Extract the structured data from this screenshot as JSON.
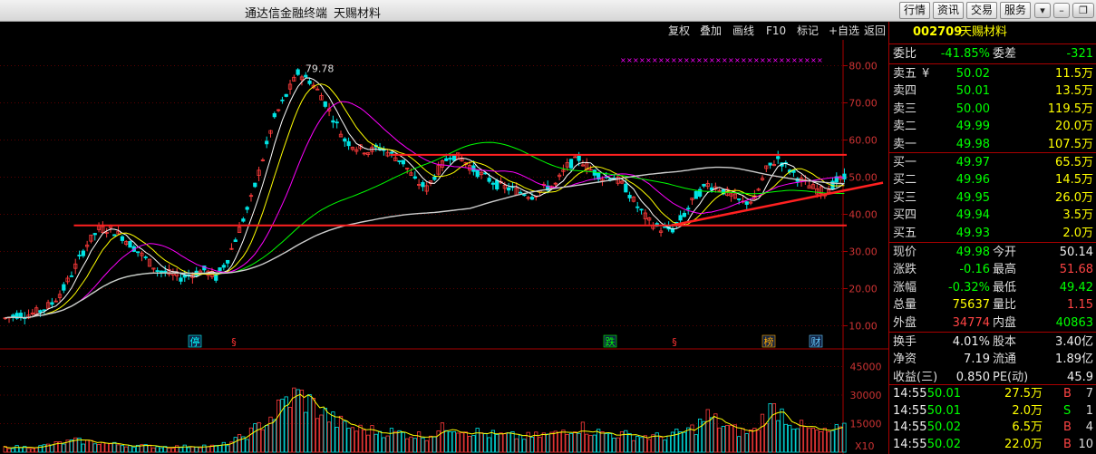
{
  "app": {
    "title": "通达信金融终端",
    "stock": "天赐材料"
  },
  "top_buttons": [
    "行情",
    "资讯",
    "交易",
    "服务"
  ],
  "window_icons": [
    "down-arrow-icon",
    "minimize-icon",
    "restore-icon",
    "close-icon"
  ],
  "chart_toolbar": [
    "复权",
    "叠加",
    "画线",
    "F10",
    "标记",
    "+自选",
    "返回"
  ],
  "panel": {
    "code": "002709",
    "name": "天赐材料",
    "weibi_label": "委比",
    "weibi": "-41.85%",
    "weicha_label": "委差",
    "weicha": "-321",
    "asks": [
      {
        "label": "卖五",
        "mark": "¥",
        "price": "50.02",
        "vol": "11.5万"
      },
      {
        "label": "卖四",
        "price": "50.01",
        "vol": "13.5万"
      },
      {
        "label": "卖三",
        "price": "50.00",
        "vol": "119.5万"
      },
      {
        "label": "卖二",
        "price": "49.99",
        "vol": "20.0万"
      },
      {
        "label": "卖一",
        "price": "49.98",
        "vol": "107.5万"
      }
    ],
    "bids": [
      {
        "label": "买一",
        "price": "49.97",
        "vol": "65.5万"
      },
      {
        "label": "买二",
        "price": "49.96",
        "vol": "14.5万"
      },
      {
        "label": "买三",
        "price": "49.95",
        "vol": "26.0万"
      },
      {
        "label": "买四",
        "price": "49.94",
        "vol": "3.5万"
      },
      {
        "label": "买五",
        "price": "49.93",
        "vol": "2.0万"
      }
    ],
    "quote": [
      {
        "l1": "现价",
        "v1": "49.98",
        "c1": "g",
        "l2": "今开",
        "v2": "50.14",
        "c2": "w"
      },
      {
        "l1": "涨跌",
        "v1": "-0.16",
        "c1": "g",
        "l2": "最高",
        "v2": "51.68",
        "c2": "r"
      },
      {
        "l1": "涨幅",
        "v1": "-0.32%",
        "c1": "g",
        "l2": "最低",
        "v2": "49.42",
        "c2": "g"
      },
      {
        "l1": "总量",
        "v1": "75637",
        "c1": "y",
        "l2": "量比",
        "v2": "1.15",
        "c2": "r"
      },
      {
        "l1": "外盘",
        "v1": "34774",
        "c1": "r",
        "l2": "内盘",
        "v2": "40863",
        "c2": "g"
      }
    ],
    "fundamentals": [
      {
        "l1": "换手",
        "v1": "4.01%",
        "l2": "股本",
        "v2": "3.40亿"
      },
      {
        "l1": "净资",
        "v1": "7.19",
        "l2": "流通",
        "v2": "1.89亿"
      },
      {
        "l1": "收益(三)",
        "v1": "0.850",
        "l2": "PE(动)",
        "v2": "45.9"
      }
    ],
    "ticks": [
      {
        "time": "14:55",
        "price": "50.01",
        "vol": "27.5万",
        "side": "B",
        "n": "7"
      },
      {
        "time": "14:55",
        "price": "50.01",
        "vol": "2.0万",
        "side": "S",
        "n": "1"
      },
      {
        "time": "14:55",
        "price": "50.02",
        "vol": "6.5万",
        "side": "B",
        "n": "4"
      },
      {
        "time": "14:55",
        "price": "50.02",
        "vol": "22.0万",
        "side": "B",
        "n": "10"
      }
    ]
  },
  "chart_data": {
    "type": "candlestick",
    "price_axis": {
      "ticks": [
        "80.00",
        "70.00",
        "60.00",
        "50.00",
        "40.00",
        "30.00",
        "20.00",
        "10.00"
      ],
      "ylim": [
        5,
        85
      ]
    },
    "volume_axis": {
      "ticks": [
        "45000",
        "30000",
        "15000"
      ],
      "unit": "X10",
      "ylim": [
        0,
        50000
      ]
    },
    "high_label": "79.78",
    "event_markers": [
      "停",
      "§",
      "跌",
      "§",
      "榜",
      "财"
    ],
    "candles_note": "approximate daily price path",
    "price_path": [
      12,
      13,
      13,
      14,
      16,
      20,
      26,
      32,
      36,
      36,
      34,
      31,
      28,
      25,
      24,
      23,
      24,
      25,
      23,
      28,
      36,
      44,
      55,
      66,
      72,
      78,
      76,
      72,
      66,
      60,
      58,
      57,
      58,
      56,
      54,
      49,
      47,
      52,
      56,
      55,
      52,
      50,
      48,
      47,
      46,
      45,
      47,
      48,
      53,
      55,
      52,
      50,
      50,
      47,
      42,
      38,
      36,
      36,
      40,
      45,
      48,
      47,
      45,
      43,
      44,
      52,
      55,
      52,
      49,
      47,
      46,
      49,
      50
    ],
    "volume_path": [
      2500,
      2800,
      2600,
      3000,
      4200,
      5000,
      6000,
      5500,
      5200,
      4300,
      3800,
      3600,
      3200,
      3000,
      2800,
      2900,
      3100,
      3400,
      3000,
      4500,
      7200,
      10500,
      15000,
      20000,
      27000,
      30000,
      26000,
      21000,
      17000,
      14000,
      12000,
      11500,
      11000,
      10500,
      9800,
      9000,
      8500,
      11000,
      14000,
      12500,
      10800,
      9600,
      8800,
      8500,
      8200,
      8000,
      9000,
      9500,
      12500,
      13500,
      11500,
      9800,
      9500,
      9000,
      8500,
      8200,
      8000,
      9000,
      10500,
      13000,
      19000,
      15000,
      12000,
      10500,
      11000,
      21000,
      23000,
      17000,
      13000,
      11000,
      10000,
      11500,
      12000
    ],
    "resistance_y": [
      56,
      37
    ],
    "trendline": [
      [
        57,
        37
      ],
      [
        72,
        48.5
      ]
    ]
  }
}
